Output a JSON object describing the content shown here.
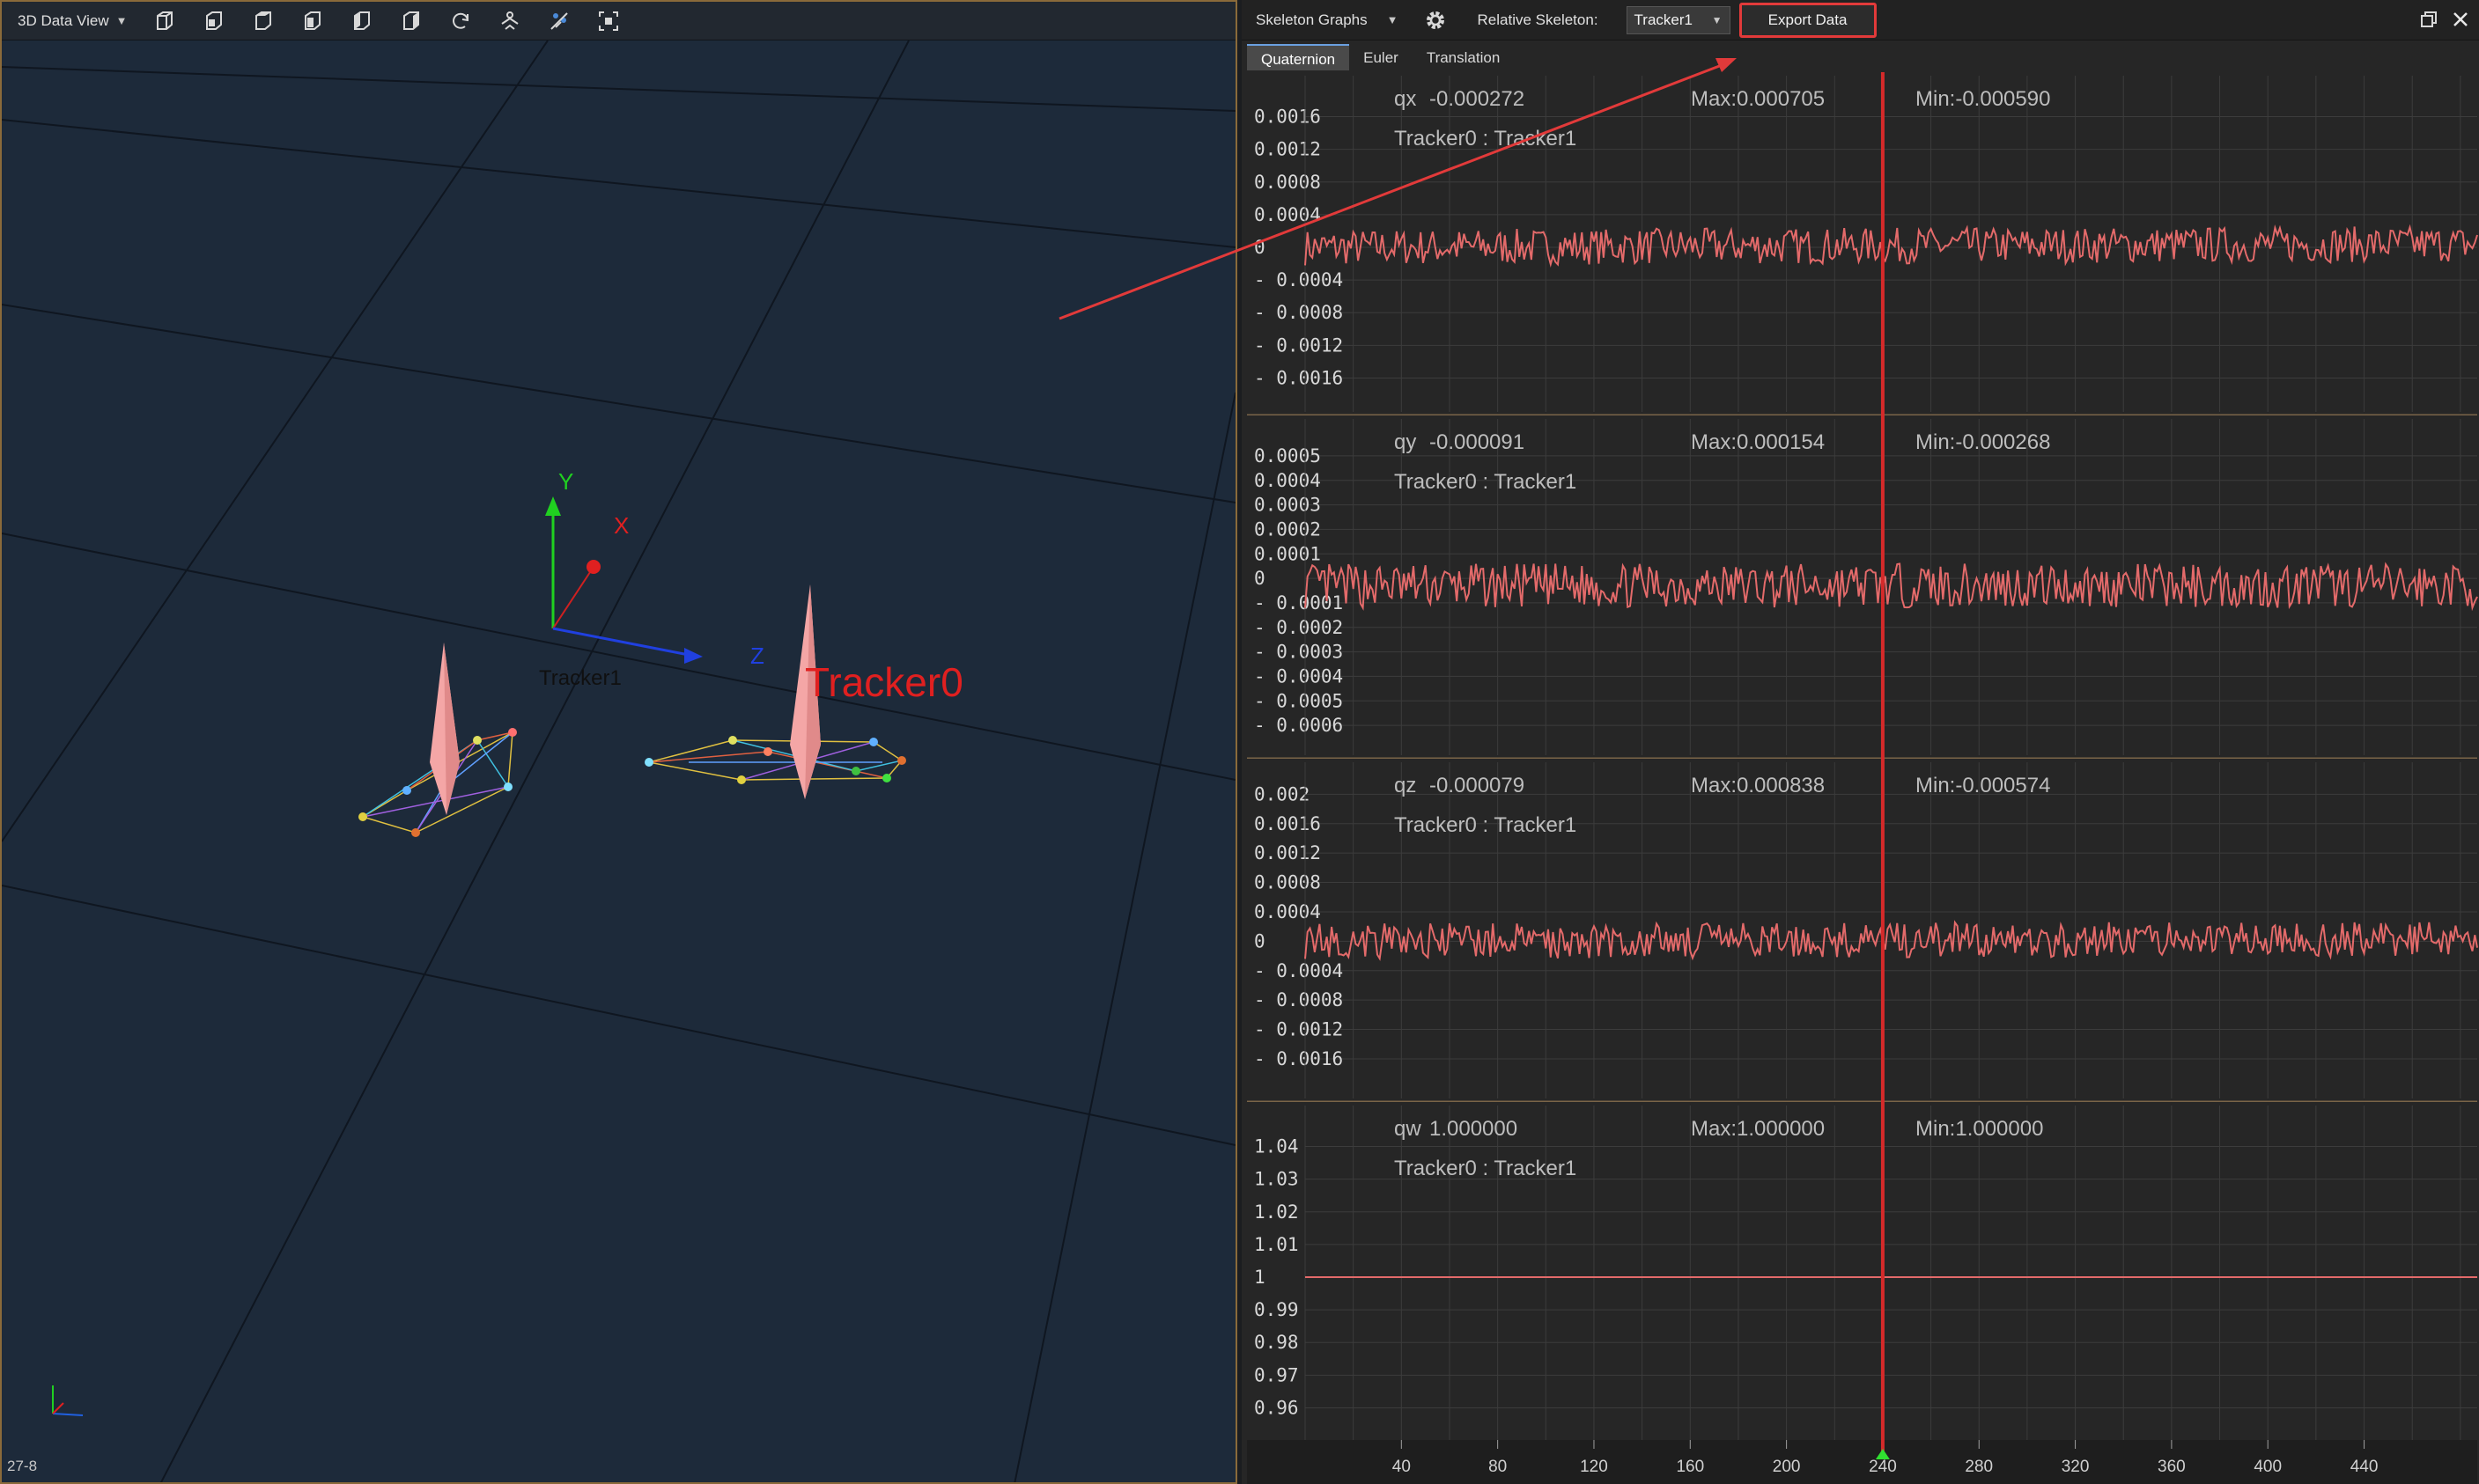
{
  "left_view": {
    "title": "3D Data View",
    "frame_label": "27-8",
    "tools": [
      "perspective-view-icon",
      "front-view-icon",
      "top-view-icon",
      "side-view-icon",
      "left-view-icon",
      "right-view-icon",
      "reset-rotation-icon",
      "tracker-display-icon",
      "marker-display-icon",
      "capture-view-icon"
    ],
    "axis_labels": {
      "x": "X",
      "y": "Y",
      "z": "Z"
    },
    "scene_labels": {
      "tracker1": "Tracker1",
      "tracker0": "Tracker0"
    },
    "colors": {
      "background": "#1d2a3a",
      "grid": "#0f1620",
      "tracker_body": "#f4a6a6",
      "label_red": "#e02020"
    }
  },
  "right_view": {
    "title": "Skeleton Graphs",
    "relative_label": "Relative Skeleton:",
    "relative_value": "Tracker1",
    "export_label": "Export Data",
    "tabs": [
      {
        "label": "Quaternion",
        "active": true
      },
      {
        "label": "Euler",
        "active": false
      },
      {
        "label": "Translation",
        "active": false
      }
    ],
    "highlight_color": "#e23a3a"
  },
  "chart_data": [
    {
      "type": "line",
      "name": "qx",
      "current": "-0.000272",
      "max": "Max:0.000705",
      "min": "Min:-0.000590",
      "subtitle": "Tracker0 : Tracker1",
      "y_ticks": [
        "0.0016",
        "0.0012",
        "0.0008",
        "0.0004",
        "0",
        "0.0004",
        "0.0008",
        "0.0012",
        "0.0016"
      ],
      "y_tick_values": [
        0.0016,
        0.0012,
        0.0008,
        0.0004,
        0,
        -0.0004,
        -0.0008,
        -0.0012,
        -0.0016
      ],
      "ylim": [
        -0.0018,
        0.0018
      ],
      "amplitude": 0.00022,
      "center": 0.0,
      "trend": 4e-05,
      "noise_seed": 7
    },
    {
      "type": "line",
      "name": "qy",
      "current": "-0.000091",
      "max": "Max:0.000154",
      "min": "Min:-0.000268",
      "subtitle": "Tracker0 : Tracker1",
      "y_ticks": [
        "0.0005",
        "0.0004",
        "0.0003",
        "0.0002",
        "0.0001",
        "0",
        "0.0001",
        "0.0002",
        "0.0003",
        "0.0004",
        "0.0005",
        "0.0006"
      ],
      "y_tick_values": [
        0.0005,
        0.0004,
        0.0003,
        0.0002,
        0.0001,
        0,
        -0.0001,
        -0.0002,
        -0.0003,
        -0.0004,
        -0.0005,
        -0.0006
      ],
      "ylim": [
        -0.00065,
        0.00055
      ],
      "amplitude": 9e-05,
      "center": -3e-05,
      "trend": 0,
      "noise_seed": 13
    },
    {
      "type": "line",
      "name": "qz",
      "current": "-0.000079",
      "max": "Max:0.000838",
      "min": "Min:-0.000574",
      "subtitle": "Tracker0 : Tracker1",
      "y_ticks": [
        "0.002",
        "0.0016",
        "0.0012",
        "0.0008",
        "0.0004",
        "0",
        "0.0004",
        "0.0008",
        "0.0012",
        "0.0016"
      ],
      "y_tick_values": [
        0.002,
        0.0016,
        0.0012,
        0.0008,
        0.0004,
        0,
        -0.0004,
        -0.0008,
        -0.0012,
        -0.0016
      ],
      "ylim": [
        -0.0019,
        0.0021
      ],
      "amplitude": 0.00024,
      "center": 0.0,
      "trend": 3e-05,
      "noise_seed": 21
    },
    {
      "type": "line",
      "name": "qw",
      "current": "1.000000",
      "max": "Max:1.000000",
      "min": "Min:1.000000",
      "subtitle": "Tracker0 : Tracker1",
      "y_ticks": [
        "1.04",
        "1.03",
        "1.02",
        "1.01",
        "1",
        "0.99",
        "0.98",
        "0.97",
        "0.96"
      ],
      "y_tick_values": [
        1.04,
        1.03,
        1.02,
        1.01,
        1,
        0.99,
        0.98,
        0.97,
        0.96
      ],
      "ylim": [
        0.955,
        1.045
      ],
      "amplitude": 0,
      "center": 1.0,
      "trend": 0,
      "noise_seed": 3
    }
  ],
  "x_axis": {
    "ticks": [
      "40",
      "80",
      "120",
      "160",
      "200",
      "240",
      "280",
      "320",
      "360",
      "400",
      "440"
    ],
    "tick_values": [
      40,
      80,
      120,
      160,
      200,
      240,
      280,
      320,
      360,
      400,
      440
    ],
    "range": [
      0,
      487
    ],
    "cursor": 240
  }
}
